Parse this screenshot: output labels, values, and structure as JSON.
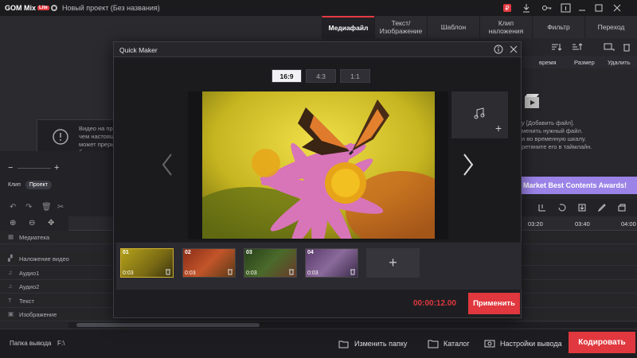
{
  "app": {
    "logo": "GOM Mix",
    "logo_badge": "Lite",
    "project_title": "Новый проект (Без названия)"
  },
  "tabs": [
    {
      "label": "Медиафайл"
    },
    {
      "label": "Текст/ Изображение"
    },
    {
      "label": "Шаблон"
    },
    {
      "label": "Клип наложения"
    },
    {
      "label": "Фильтр"
    },
    {
      "label": "Переход"
    }
  ],
  "media_panel": {
    "columns": [
      "время",
      "Размер",
      "Удалить"
    ],
    "info_lines": [
      "у [Добавить файл].",
      "менить нужный файл.",
      "и во временную шкалу.",
      "ретяните его в таймлайн."
    ],
    "banner": "Market Best Contents Awards!"
  },
  "preview": {
    "notice_lines": [
      "Видео на прев",
      "чем настоящи",
      "может прерыв",
      "быть вставлен"
    ]
  },
  "left_controls": {
    "clip_label": "Клип",
    "project_label": "Проект"
  },
  "timeline": {
    "ruler_labels": [
      "03:20",
      "03:40",
      "04:00"
    ],
    "tracks": [
      "Медиатека",
      "Наложение видео",
      "Аудио1",
      "Аудио2",
      "Текст",
      "Изображение"
    ]
  },
  "dialog": {
    "title": "Quick Maker",
    "ratios": [
      "16:9",
      "4:3",
      "1:1"
    ],
    "selected_ratio": "16:9",
    "clips": [
      {
        "num": "01",
        "duration": "0:03"
      },
      {
        "num": "02",
        "duration": "0:03"
      },
      {
        "num": "03",
        "duration": "0:03"
      },
      {
        "num": "04",
        "duration": "0:03"
      }
    ],
    "add_clip": "+",
    "timecode": "00:00:12.00",
    "apply": "Применить"
  },
  "bottom_bar": {
    "output_folder_label": "Папка вывода",
    "output_path": "F:\\",
    "change_folder": "Изменить папку",
    "catalog": "Каталог",
    "output_settings": "Настройки вывода",
    "encode": "Кодировать"
  },
  "colors": {
    "accent": "#e0383e",
    "banner": "#9b83e8",
    "dialog_bg": "#1e1e22"
  }
}
